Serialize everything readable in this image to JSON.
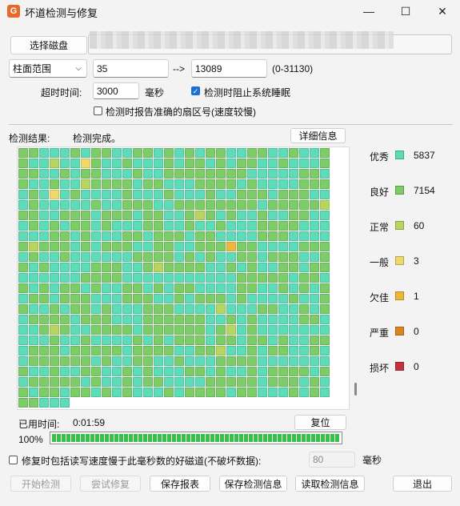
{
  "window": {
    "title": "坏道检测与修复",
    "minimize_icon": "minimize-icon",
    "maximize_icon": "maximize-icon",
    "close_icon": "close-icon"
  },
  "disk": {
    "select_label": "选择磁盘"
  },
  "range": {
    "mode": "柱面范围",
    "start": "35",
    "arrow": "-->",
    "end": "13089",
    "limit": "(0-31130)"
  },
  "timeout": {
    "label": "超时时间:",
    "value": "3000",
    "unit": "毫秒"
  },
  "options": {
    "prevent_sleep": "检测时阻止系统睡眠",
    "prevent_sleep_checked": true,
    "report_sector": "检测时报告准确的扇区号(速度较慢)",
    "report_sector_checked": false
  },
  "result": {
    "label": "检测结果:",
    "status": "检测完成。",
    "details_button": "详细信息"
  },
  "legend": [
    {
      "label": "优秀",
      "count": "5837",
      "color": "#5ddcb8"
    },
    {
      "label": "良好",
      "count": "7154",
      "color": "#7ccd67"
    },
    {
      "label": "正常",
      "count": "60",
      "color": "#b8d561"
    },
    {
      "label": "一般",
      "count": "3",
      "color": "#f0d96a"
    },
    {
      "label": "欠佳",
      "count": "1",
      "color": "#f0b63a"
    },
    {
      "label": "严重",
      "count": "0",
      "color": "#dd8420"
    },
    {
      "label": "损坏",
      "count": "0",
      "color": "#c8303a"
    }
  ],
  "status": {
    "elapsed_label": "已用时间:",
    "elapsed": "0:01:59",
    "reset_button": "复位",
    "progress_text": "100%",
    "progress": 1.0
  },
  "repair_option": {
    "label": "修复时包括读写速度慢于此毫秒数的好磁道(不破坏数据):",
    "value": "80",
    "unit": "毫秒",
    "checked": false
  },
  "buttons": {
    "start": "开始检测",
    "try_repair": "尝试修复",
    "save_report": "保存报表",
    "save_info": "保存检测信息",
    "read_info": "读取检测信息",
    "exit": "退出"
  }
}
